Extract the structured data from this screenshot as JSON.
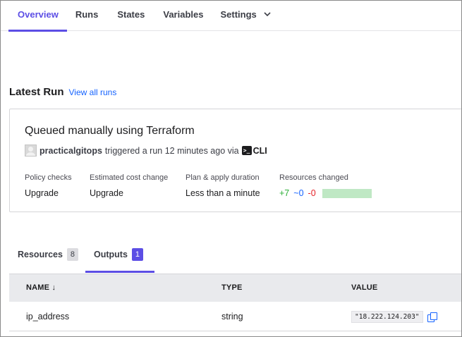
{
  "nav": {
    "tabs": [
      {
        "label": "Overview",
        "active": true
      },
      {
        "label": "Runs"
      },
      {
        "label": "States"
      },
      {
        "label": "Variables"
      },
      {
        "label": "Settings",
        "icon": "chevron-down-icon"
      }
    ]
  },
  "latest_run": {
    "heading": "Latest Run",
    "view_all_link": "View all runs",
    "title": "Queued manually using Terraform",
    "user": "practicalgitops",
    "action_text": "triggered a run 12 minutes ago via",
    "source_icon": "terminal-icon",
    "source": "CLI",
    "stats": {
      "policy_checks": {
        "label": "Policy checks",
        "value": "Upgrade"
      },
      "cost_change": {
        "label": "Estimated cost change",
        "value": "Upgrade"
      },
      "duration": {
        "label": "Plan & apply duration",
        "value": "Less than a minute"
      },
      "resources_changed": {
        "label": "Resources changed",
        "added": "+7",
        "changed": "~0",
        "destroyed": "-0"
      }
    }
  },
  "subtabs": {
    "resources": {
      "label": "Resources",
      "count": "8"
    },
    "outputs": {
      "label": "Outputs",
      "count": "1",
      "active": true
    }
  },
  "outputs_table": {
    "columns": {
      "name": "NAME ↓",
      "type": "TYPE",
      "value": "VALUE"
    },
    "rows": [
      {
        "name": "ip_address",
        "type": "string",
        "value": "\"18.222.124.203\""
      }
    ]
  },
  "colors": {
    "accent": "#5c4ee5",
    "link": "#1563ff",
    "add": "#2eb039",
    "destroy": "#e52228",
    "bar_fill": "#bfe8c4"
  }
}
